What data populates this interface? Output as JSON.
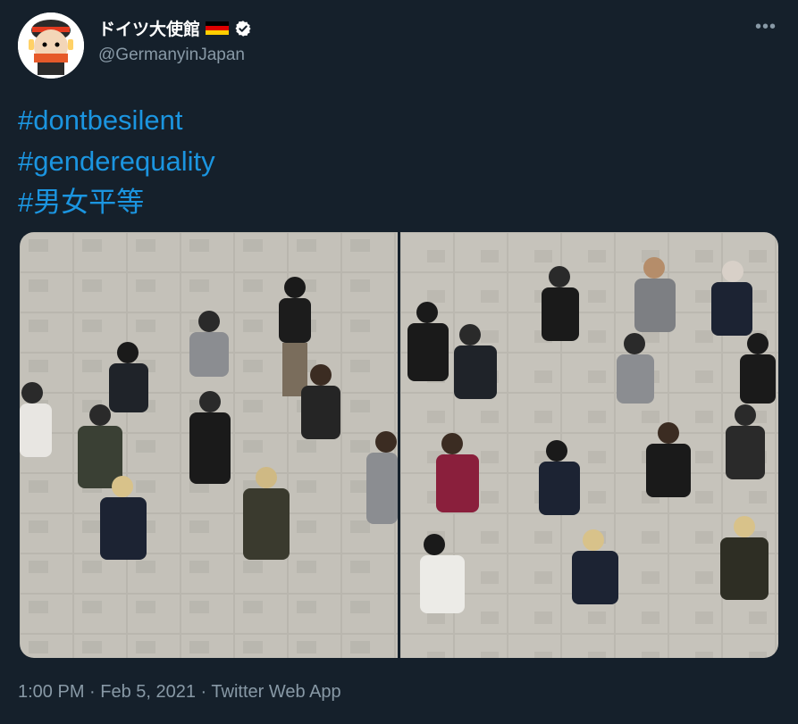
{
  "tweet": {
    "display_name": "ドイツ大使館",
    "handle": "@GermanyinJapan",
    "more_label": "•••",
    "hashtags": [
      "#dontbesilent",
      "#genderequality",
      "#男女平等"
    ],
    "timestamp": "1:00 PM · Feb 5, 2021 · ",
    "source": "Twitter Web App",
    "media_count": 2
  },
  "icons": {
    "flag": "german-flag-icon",
    "verified": "verified-badge-icon",
    "more": "more-options-icon"
  },
  "colors": {
    "background": "#15202b",
    "link": "#1b95e0",
    "secondary_text": "#8899a6",
    "verified_badge": "#ffffff",
    "flag": [
      "#000000",
      "#dd0000",
      "#ffce00"
    ]
  }
}
